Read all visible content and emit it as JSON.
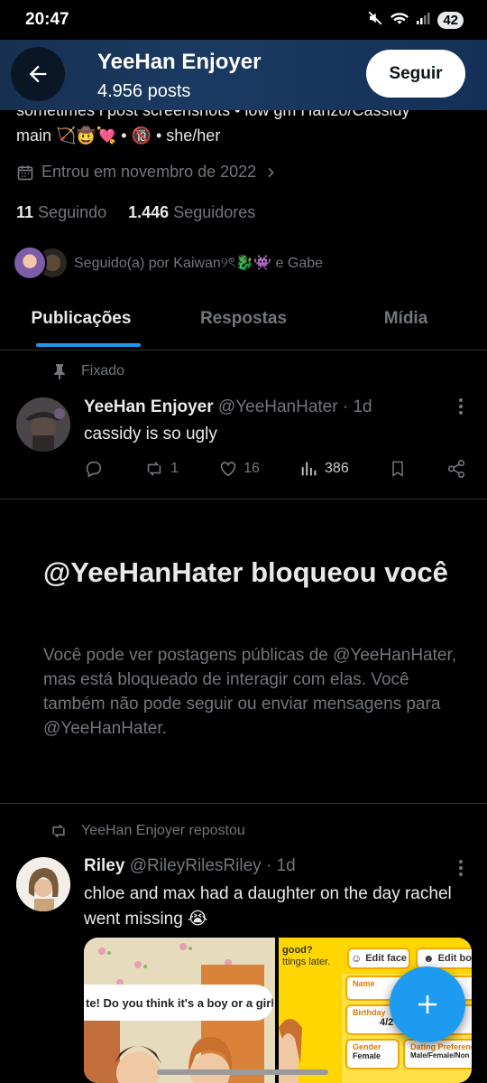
{
  "status_bar": {
    "time": "20:47",
    "battery": "42"
  },
  "header": {
    "name": "YeeHan Enjoyer",
    "posts": "4.956 posts",
    "follow_label": "Seguir"
  },
  "bio": {
    "line1": "sometimes i post screenshots • low gm Hanzo/Cassidy",
    "line2": "main 🏹🤠💘 • 🔞 • she/her"
  },
  "joined": "Entrou em novembro de 2022",
  "stats": {
    "following_count": "11",
    "following_label": "Seguindo",
    "followers_count": "1.446",
    "followers_label": "Seguidores"
  },
  "followed_by": "Seguido(a) por Kaiwan୨ৎ🐉👾 e Gabe",
  "tabs": [
    {
      "label": "Publicações"
    },
    {
      "label": "Respostas"
    },
    {
      "label": "Mídia"
    }
  ],
  "pinned_tweet": {
    "pinned_label": "Fixado",
    "name": "YeeHan Enjoyer",
    "handle": "@YeeHanHater",
    "time": "· 1d",
    "text": "cassidy is so ugly",
    "retweets": "1",
    "likes": "16",
    "views": "386"
  },
  "blocked": {
    "title": "@YeeHanHater bloqueou você",
    "description": "Você pode ver postagens públicas de @YeeHanHater, mas está bloqueado de interagir com elas. Você também não pode seguir ou enviar mensagens para @YeeHanHater."
  },
  "repost_tweet": {
    "repost_label": "YeeHan Enjoyer repostou",
    "name": "Riley",
    "handle": "@RileyRilesRiley",
    "time": "· 1d",
    "text": "chloe and max had a daughter on the day rachel went missing 😭",
    "media_left_text": "te! Do you think it's a boy or a girl?",
    "media_right": {
      "top_text1": "good?",
      "top_text2": "ttings later.",
      "edit_face": "Edit face",
      "edit_body": "Edit body",
      "name_label": "Name",
      "birthday_label": "Birthday",
      "birthday_value": "4/2",
      "gender_label": "Gender",
      "gender_value": "Female",
      "dating_label": "Dating Preference",
      "dating_value": "Male/Female/Non"
    }
  }
}
